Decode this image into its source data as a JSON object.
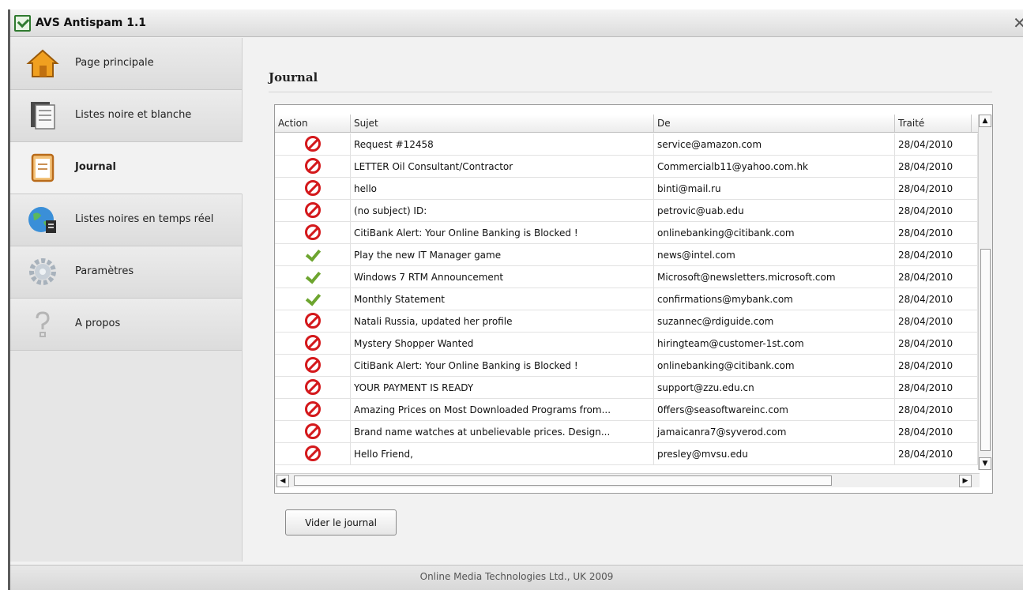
{
  "window": {
    "title": "AVS Antispam 1.1"
  },
  "sidebar": {
    "items": [
      {
        "label": "Page principale",
        "icon": "home-icon"
      },
      {
        "label": "Listes noire et blanche",
        "icon": "list-document-icon"
      },
      {
        "label": "Journal",
        "icon": "journal-icon",
        "active": true
      },
      {
        "label": "Listes noires en temps réel",
        "icon": "globe-icon"
      },
      {
        "label": "Paramètres",
        "icon": "gear-icon"
      },
      {
        "label": "A propos",
        "icon": "question-icon"
      }
    ]
  },
  "main": {
    "title": "Journal",
    "columns": [
      "Action",
      "Sujet",
      "De",
      "Traité"
    ],
    "rows": [
      {
        "action": "blocked",
        "subject": "Request #12458",
        "from": "service@amazon.com",
        "date": "28/04/2010"
      },
      {
        "action": "blocked",
        "subject": "LETTER Oil Consultant/Contractor",
        "from": "Commercialb11@yahoo.com.hk",
        "date": "28/04/2010"
      },
      {
        "action": "blocked",
        "subject": "hello",
        "from": "binti@mail.ru",
        "date": "28/04/2010"
      },
      {
        "action": "blocked",
        "subject": "(no subject) ID:",
        "from": "petrovic@uab.edu",
        "date": "28/04/2010"
      },
      {
        "action": "blocked",
        "subject": "CitiBank Alert: Your Online Banking is Blocked !",
        "from": "onlinebanking@citibank.com",
        "date": "28/04/2010"
      },
      {
        "action": "allowed",
        "subject": "Play the new IT Manager game",
        "from": "news@intel.com",
        "date": "28/04/2010"
      },
      {
        "action": "allowed",
        "subject": "Windows 7 RTM Announcement",
        "from": "Microsoft@newsletters.microsoft.com",
        "date": "28/04/2010"
      },
      {
        "action": "allowed",
        "subject": "Monthly Statement",
        "from": "confirmations@mybank.com",
        "date": "28/04/2010"
      },
      {
        "action": "blocked",
        "subject": "Natali Russia, updated her profile",
        "from": "suzannec@rdiguide.com",
        "date": "28/04/2010"
      },
      {
        "action": "blocked",
        "subject": "Mystery Shopper Wanted",
        "from": "hiringteam@customer-1st.com",
        "date": "28/04/2010"
      },
      {
        "action": "blocked",
        "subject": "CitiBank Alert: Your Online Banking is Blocked !",
        "from": "onlinebanking@citibank.com",
        "date": "28/04/2010"
      },
      {
        "action": "blocked",
        "subject": "YOUR PAYMENT IS READY",
        "from": "support@zzu.edu.cn",
        "date": "28/04/2010"
      },
      {
        "action": "blocked",
        "subject": "Amazing Prices on Most Downloaded Programs from...",
        "from": "0ffers@seasoftwareinc.com",
        "date": "28/04/2010"
      },
      {
        "action": "blocked",
        "subject": "Brand name watches at unbelievable prices. Design...",
        "from": "jamaicanra7@syverod.com",
        "date": "28/04/2010"
      },
      {
        "action": "blocked",
        "subject": "Hello Friend,",
        "from": "presley@mvsu.edu",
        "date": "28/04/2010"
      }
    ],
    "clear_button": "Vider le journal"
  },
  "footer": {
    "text": "Online Media Technologies Ltd., UK 2009"
  },
  "colors": {
    "blocked": "#d4191c",
    "allowed": "#6da52f"
  }
}
